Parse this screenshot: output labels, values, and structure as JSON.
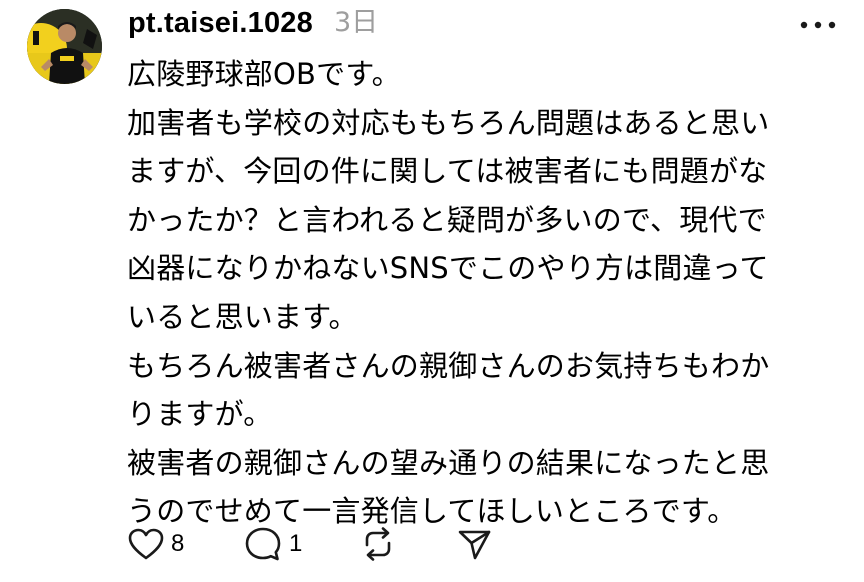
{
  "post": {
    "username": "pt.taisei.1028",
    "timestamp": "3日",
    "body_lines": [
      "広陵野球部OBです。",
      "加害者も学校の対応ももちろん問題はあると思い",
      "ますが、今回の件に関しては被害者にも問題がな",
      "かったか？と言われると疑問が多いので、現代で",
      "凶器になりかねないSNSでこのやり方は間違って",
      "いると思います。",
      "もちろん被害者さんの親御さんのお気持ちもわか",
      "りますが。",
      "被害者の親御さんの望み通りの結果になったと思",
      "うのでせめて一言発信してほしいところです。"
    ]
  },
  "actions": {
    "like_count": "8",
    "reply_count": "1"
  },
  "icons": {
    "more": "more-horizontal-icon",
    "like": "heart-icon",
    "reply": "comment-bubble-icon",
    "repost": "repost-icon",
    "share": "send-icon"
  },
  "colors": {
    "text": "#000000",
    "muted": "#9e9e9e",
    "icon": "#1a1a1a",
    "background": "#ffffff"
  }
}
